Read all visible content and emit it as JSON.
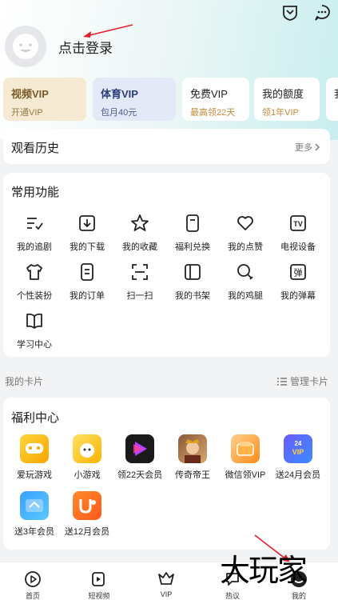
{
  "header": {
    "login_text": "点击登录"
  },
  "vip_cards": [
    {
      "title": "视频VIP",
      "sub": "开通VIP",
      "title_color": "#7a5a2a",
      "sub_color": "#9a7a44",
      "bg": "#f6ead2"
    },
    {
      "title": "体育VIP",
      "sub": "包月40元",
      "title_color": "#2c3e7a",
      "sub_color": "#4a5a8e",
      "bg": "#e4e9f8"
    },
    {
      "title": "免费VIP",
      "sub": "最高领22天",
      "title_color": "#222222",
      "sub_color": "#c78a3a",
      "bg": "#ffffff"
    },
    {
      "title": "我的额度",
      "sub": "领1年VIP",
      "title_color": "#222222",
      "sub_color": "#c78a3a",
      "bg": "#ffffff"
    },
    {
      "title": "我",
      "sub": "",
      "title_color": "#222222",
      "sub_color": "#c78a3a",
      "bg": "#ffffff"
    }
  ],
  "history": {
    "title": "观看历史",
    "more": "更多"
  },
  "common": {
    "title": "常用功能",
    "items": [
      {
        "label": "我的追剧",
        "icon": "checklist-icon"
      },
      {
        "label": "我的下载",
        "icon": "download-icon"
      },
      {
        "label": "我的收藏",
        "icon": "star-icon"
      },
      {
        "label": "福利兑换",
        "icon": "coupon-icon"
      },
      {
        "label": "我的点赞",
        "icon": "heart-icon"
      },
      {
        "label": "电视设备",
        "icon": "tv-icon"
      },
      {
        "label": "个性装扮",
        "icon": "tshirt-icon"
      },
      {
        "label": "我的订单",
        "icon": "order-icon"
      },
      {
        "label": "扫一扫",
        "icon": "scan-icon"
      },
      {
        "label": "我的书架",
        "icon": "bookshelf-icon"
      },
      {
        "label": "我的鸡腿",
        "icon": "drumstick-icon"
      },
      {
        "label": "我的弹幕",
        "icon": "danmaku-icon"
      },
      {
        "label": "学习中心",
        "icon": "book-icon"
      }
    ]
  },
  "my_cards": {
    "label": "我的卡片",
    "manage": "管理卡片"
  },
  "welfare": {
    "title": "福利中心",
    "items": [
      {
        "label": "爱玩游戏",
        "icon": "game-app-icon"
      },
      {
        "label": "小游戏",
        "icon": "minigame-app-icon"
      },
      {
        "label": "领22天会员",
        "icon": "video-app-icon"
      },
      {
        "label": "传奇帝王",
        "icon": "legend-game-icon"
      },
      {
        "label": "微信领VIP",
        "icon": "wechat-vip-icon"
      },
      {
        "label": "送24月会员",
        "icon": "vip24-icon"
      },
      {
        "label": "送3年会员",
        "icon": "vip3year-icon"
      },
      {
        "label": "送12月会员",
        "icon": "uc-app-icon"
      }
    ]
  },
  "bottom_nav": [
    {
      "label": "首页",
      "icon": "home-play-icon"
    },
    {
      "label": "短视频",
      "icon": "short-video-icon"
    },
    {
      "label": "VIP",
      "icon": "vip-crown-icon"
    },
    {
      "label": "热议",
      "icon": "discussion-icon"
    },
    {
      "label": "我的",
      "icon": "profile-icon"
    }
  ],
  "watermark": "大玩家"
}
